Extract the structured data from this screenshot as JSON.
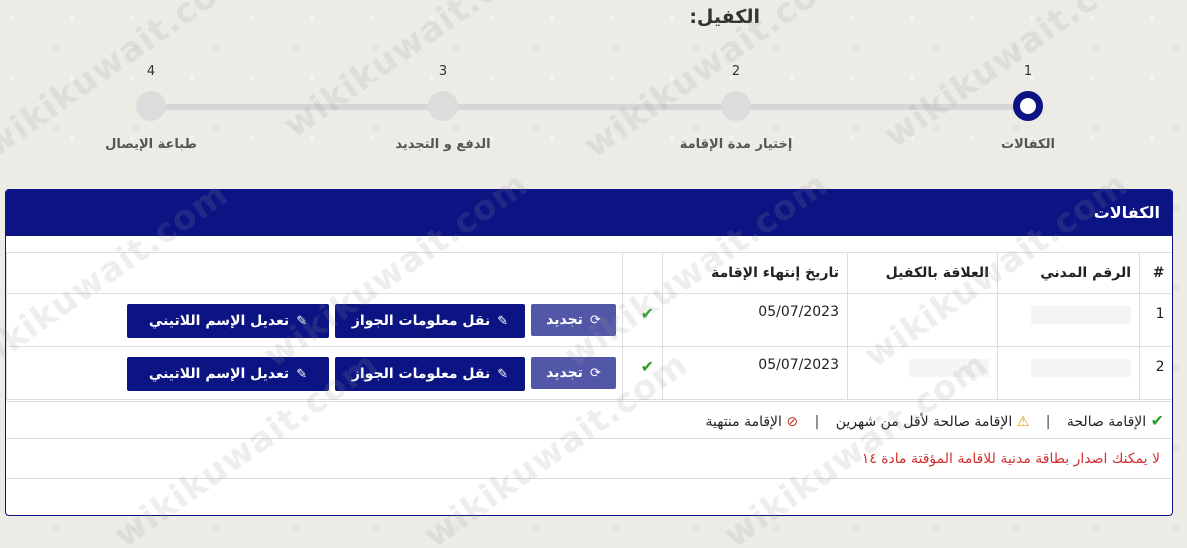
{
  "page": {
    "title": "الكفيل:"
  },
  "stepper": {
    "steps": [
      {
        "num": "1",
        "label": "الكفالات",
        "active": true
      },
      {
        "num": "2",
        "label": "إختيار مدة الإقامة",
        "active": false
      },
      {
        "num": "3",
        "label": "الدفع و التجديد",
        "active": false
      },
      {
        "num": "4",
        "label": "طباعة الإيصال",
        "active": false
      }
    ]
  },
  "panel": {
    "title": "الكفالات",
    "table": {
      "headers": [
        "#",
        "الرقم المدني",
        "العلاقة بالكفيل",
        "تاريخ إنتهاء الإقامة",
        "",
        ""
      ],
      "rows": [
        {
          "index": "1",
          "civil_id": "",
          "relation": "",
          "expiry": "05/07/2023",
          "status": "valid"
        },
        {
          "index": "2",
          "civil_id": "",
          "relation": "",
          "expiry": "05/07/2023",
          "status": "valid"
        }
      ]
    },
    "buttons": {
      "renew": "تجديد",
      "transfer_passport": "نقل معلومات الجواز",
      "edit_latin_name": "تعديل الإسم اللاتيني"
    },
    "legend": {
      "valid": "الإقامة صالحة",
      "expiring": "الإقامة صالحة لأقل من شهرين",
      "expired": "الإقامة منتهية",
      "separator": "|"
    },
    "note": "لا يمكنك اصدار بطاقة مدنية للاقامة المؤقتة مادة ١٤"
  },
  "watermark": "wikikuwait.com",
  "colors": {
    "primary": "#0c1484",
    "renew_button": "#5357a8",
    "valid": "#2aa02a",
    "warning": "#e0a010",
    "expired": "#c0392b",
    "note": "#d32f2f"
  },
  "icons": {
    "renew": "refresh-icon",
    "edit": "edit-icon",
    "valid": "check-icon",
    "expiring": "warning-icon",
    "expired": "ban-icon"
  }
}
